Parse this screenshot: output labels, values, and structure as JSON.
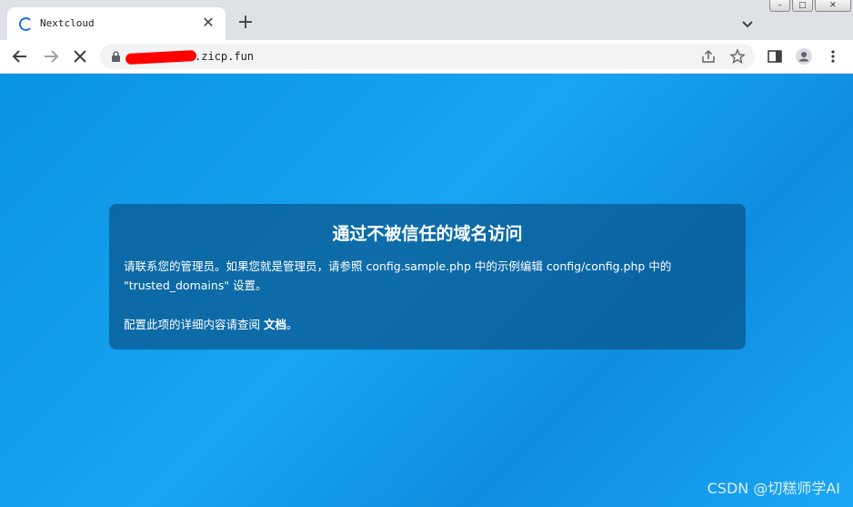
{
  "tab": {
    "title": "Nextcloud",
    "close": "✕"
  },
  "newtab": "+",
  "window": {
    "minimize": "–",
    "restore": "□",
    "close": "✕"
  },
  "address": {
    "url": ".zicp.fun"
  },
  "card": {
    "title": "通过不被信任的域名访问",
    "text1": "请联系您的管理员。如果您就是管理员，请参照 config.sample.php 中的示例编辑 config/config.php 中的 \"trusted_domains\" 设置。",
    "text2": "配置此项的详细内容请查阅",
    "link": "文档",
    "end": "。"
  },
  "watermark": "CSDN @切糕师学AI",
  "colors": {
    "accent": "#1a73e8",
    "page_bg": "#12a0ee",
    "card_bg": "#0a4b7d",
    "redaction": "#ff0000"
  }
}
